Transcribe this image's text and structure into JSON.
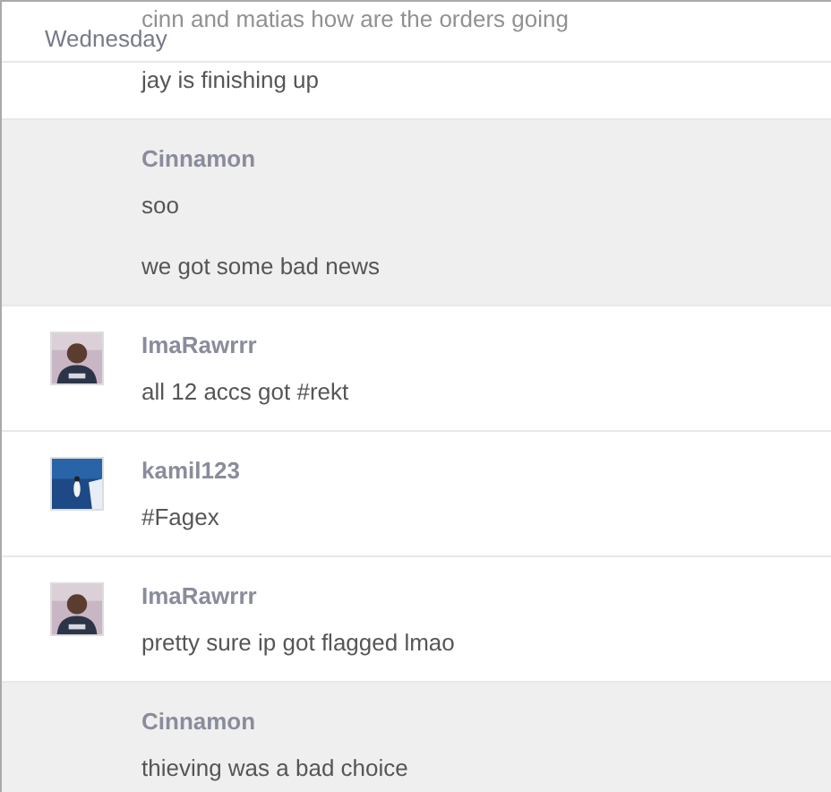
{
  "day_header": {
    "label": "Wednesday"
  },
  "message_groups": [
    {
      "highlighted": false,
      "messages": [
        "cinn and matias how are the orders going",
        "jay is finishing up"
      ]
    },
    {
      "highlighted": true,
      "sender": "Cinnamon",
      "messages": [
        "soo",
        "we got some bad news"
      ]
    },
    {
      "highlighted": false,
      "sender": "ImaRawrrr",
      "avatar": {
        "kind": "portrait"
      },
      "messages": [
        "all 12 accs got #rekt"
      ]
    },
    {
      "highlighted": false,
      "sender": "kamil123",
      "avatar": {
        "kind": "snow_scene"
      },
      "messages": [
        "#Fagex"
      ]
    },
    {
      "highlighted": false,
      "sender": "ImaRawrrr",
      "avatar": {
        "kind": "portrait"
      },
      "messages": [
        "pretty sure ip got flagged lmao"
      ]
    },
    {
      "highlighted": true,
      "sender": "Cinnamon",
      "messages": [
        "thieving was a bad choice"
      ]
    }
  ]
}
